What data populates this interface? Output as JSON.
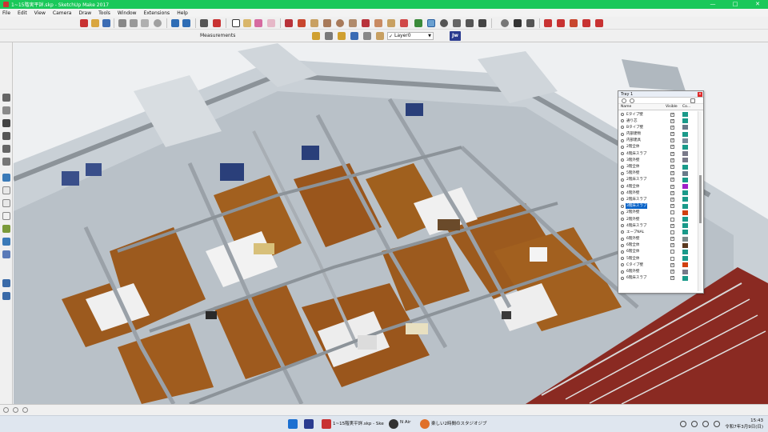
{
  "window": {
    "title": "1~15階実平詳.skp - SketchUp Make 2017",
    "controls": {
      "minimize": "—",
      "maximize": "□",
      "close": "✕"
    }
  },
  "menu": [
    "File",
    "Edit",
    "View",
    "Camera",
    "Draw",
    "Tools",
    "Window",
    "Extensions",
    "Help"
  ],
  "toolbar": {
    "measurements_label": "Measurements",
    "layer_value": "Layer0",
    "jw_label": "Jw"
  },
  "tray": {
    "title": "Tray 1",
    "columns": {
      "name": "Name",
      "visible": "Visible",
      "color": "Co..."
    },
    "layers": [
      {
        "name": "Eタイプ壁",
        "visible": true,
        "color": "#1a9a8a"
      },
      {
        "name": "通り芯",
        "visible": true,
        "color": "#1a9a8a"
      },
      {
        "name": "Bタイプ壁",
        "visible": true,
        "color": "#6a7a8a"
      },
      {
        "name": "内部建物",
        "visible": true,
        "color": "#1a9a8a"
      },
      {
        "name": "内部建具",
        "visible": true,
        "color": "#7a8a9a"
      },
      {
        "name": "2階全体",
        "visible": true,
        "color": "#1a9a8a"
      },
      {
        "name": "4階床スラブ",
        "visible": true,
        "color": "#7a7a8a"
      },
      {
        "name": "3階外壁",
        "visible": true,
        "color": "#7a7a8a"
      },
      {
        "name": "3階全体",
        "visible": true,
        "color": "#1a9a8a"
      },
      {
        "name": "5階外壁",
        "visible": true,
        "color": "#6a7a8a"
      },
      {
        "name": "2階床スラブ",
        "visible": true,
        "color": "#1a9a8a"
      },
      {
        "name": "4階全体",
        "visible": true,
        "color": "#a020c8"
      },
      {
        "name": "4階外壁",
        "visible": true,
        "color": "#1a9a8a"
      },
      {
        "name": "2階床スラブ",
        "visible": true,
        "color": "#1a9a8a"
      },
      {
        "name": "3階床スラブ",
        "visible": true,
        "color": "#1a9a8a",
        "selected": true
      },
      {
        "name": "2階外壁",
        "visible": false,
        "color": "#d04010"
      },
      {
        "name": "2階外壁",
        "visible": false,
        "color": "#1a9a8a"
      },
      {
        "name": "4階床スラブ",
        "visible": true,
        "color": "#1a9a8a"
      },
      {
        "name": "エーブNAL",
        "visible": false,
        "color": "#1a9a8a"
      },
      {
        "name": "6階外壁",
        "visible": true,
        "color": "#7a8a8a"
      },
      {
        "name": "6階全体",
        "visible": true,
        "color": "#5a3a20"
      },
      {
        "name": "6階全体",
        "visible": false,
        "color": "#1a9a8a"
      },
      {
        "name": "5階全体",
        "visible": false,
        "color": "#1a9a8a"
      },
      {
        "name": "Cタイプ壁",
        "visible": true,
        "color": "#d04010"
      },
      {
        "name": "6階外壁",
        "visible": true,
        "color": "#7a7a8a"
      },
      {
        "name": "6階床スラブ",
        "visible": true,
        "color": "#1a9a8a"
      }
    ]
  },
  "taskbar": {
    "items": [
      {
        "label": "1~15階実平詳.skp - Ske"
      },
      {
        "label": "N Air"
      },
      {
        "label": "楽しい2時間のスタジオジブ"
      }
    ],
    "time": "15:43",
    "date": "令和7年3月9日(日)"
  }
}
